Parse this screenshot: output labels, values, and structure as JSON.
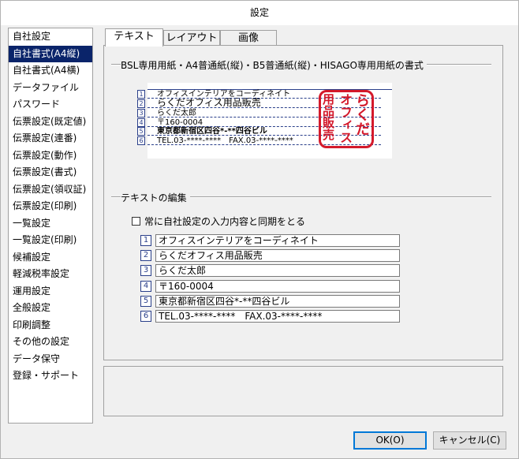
{
  "window": {
    "title": "設定"
  },
  "sidebar": {
    "items": [
      {
        "label": "自社設定"
      },
      {
        "label": "自社書式(A4縦)",
        "selected": true
      },
      {
        "label": "自社書式(A4横)"
      },
      {
        "label": "データファイル"
      },
      {
        "label": "パスワード"
      },
      {
        "label": "伝票設定(既定値)"
      },
      {
        "label": "伝票設定(連番)"
      },
      {
        "label": "伝票設定(動作)"
      },
      {
        "label": "伝票設定(書式)"
      },
      {
        "label": "伝票設定(領収証)"
      },
      {
        "label": "伝票設定(印刷)"
      },
      {
        "label": "一覧設定"
      },
      {
        "label": "一覧設定(印刷)"
      },
      {
        "label": "候補設定"
      },
      {
        "label": "軽減税率設定"
      },
      {
        "label": "運用設定"
      },
      {
        "label": "全般設定"
      },
      {
        "label": "印刷調整"
      },
      {
        "label": "その他の設定"
      },
      {
        "label": "データ保守"
      },
      {
        "label": "登録・サポート"
      }
    ]
  },
  "tabs": [
    {
      "label": "テキスト",
      "active": true
    },
    {
      "label": "レイアウト"
    },
    {
      "label": "画像"
    }
  ],
  "preview_group": {
    "label": "BSL専用用紙・A4普通紙(縦)・B5普通紙(縦)・HISAGO専用用紙の書式"
  },
  "preview": {
    "lines": [
      {
        "num": "1",
        "text": "オフィスインテリアをコーディネイト"
      },
      {
        "num": "2",
        "text": "らくだオフィス用品販売"
      },
      {
        "num": "3",
        "text": "らくだ太郎"
      },
      {
        "num": "4",
        "text": "〒160-0004"
      },
      {
        "num": "5",
        "text": "東京都新宿区四谷*-**四谷ビル"
      },
      {
        "num": "6",
        "text": "TEL.03-****-****　FAX.03-****-****"
      }
    ],
    "stamp": {
      "columns": [
        "らくだ",
        "オフィス",
        "用品販売"
      ],
      "color": "#d4192b"
    }
  },
  "edit_group": {
    "label": "テキストの編集",
    "sync_checkbox": {
      "label": "常に自社設定の入力内容と同期をとる",
      "checked": false
    },
    "fields": [
      {
        "num": "1",
        "value": "オフィスインテリアをコーディネイト"
      },
      {
        "num": "2",
        "value": "らくだオフィス用品販売"
      },
      {
        "num": "3",
        "value": "らくだ太郎"
      },
      {
        "num": "4",
        "value": "〒160-0004"
      },
      {
        "num": "5",
        "value": "東京都新宿区四谷*-**四谷ビル"
      },
      {
        "num": "6",
        "value": "TEL.03-****-****　FAX.03-****-****"
      }
    ]
  },
  "buttons": {
    "ok": "OK(O)",
    "cancel": "キャンセル(C)"
  },
  "colors": {
    "selection": "#0a246a",
    "number_box": "#2a3f8a",
    "stamp_red": "#d4192b"
  }
}
